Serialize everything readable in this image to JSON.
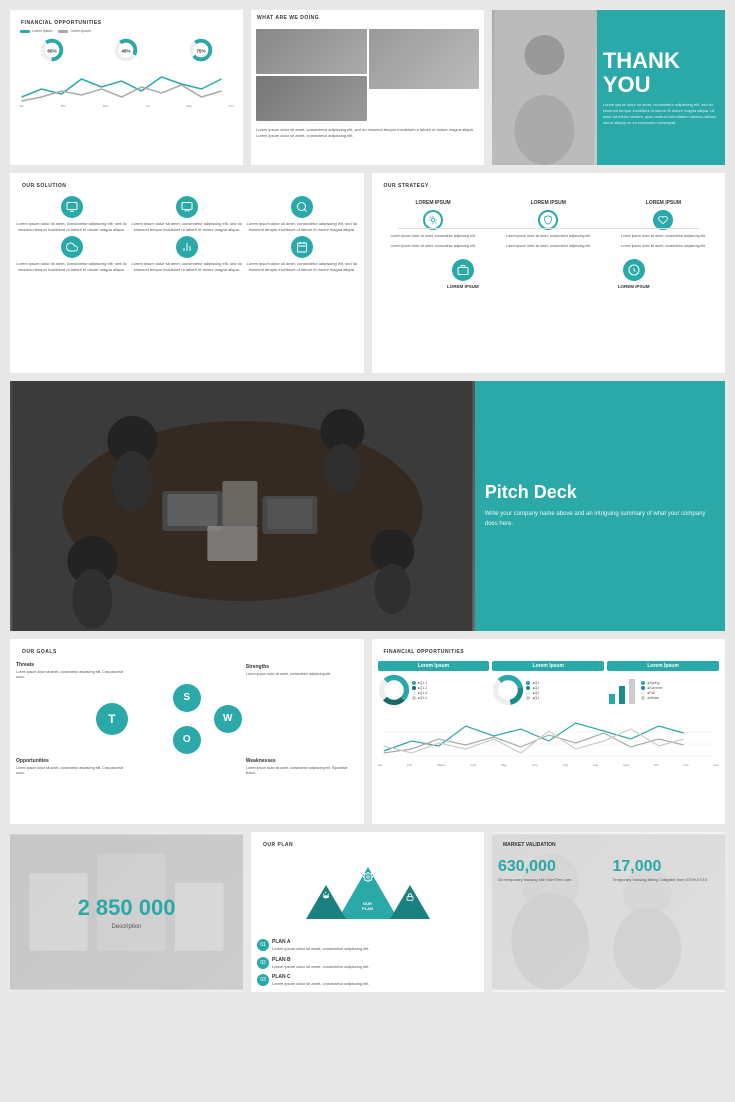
{
  "slides": {
    "row1": {
      "slide1": {
        "title": "FINANCIAL OPPORTUNITIES",
        "donut1": {
          "color": "#2ba8a8",
          "value": 65
        },
        "donut2": {
          "color": "#2ba8a8",
          "value": 45
        },
        "donut3": {
          "color": "#2ba8a8",
          "value": 75
        }
      },
      "slide2": {
        "title": "WHAT ARE WE DOING",
        "body_text": "Lorem ipsum dolor sit amet, consectetur adipiscing elit, sed do eiusmod tempor incididunt ut labore et dolore magna aliqua."
      },
      "slide3": {
        "title": "THANK YOU",
        "body_text": "Lorem ipsum dolor sit amet, consectetur adipiscing elit, sed do eiusmod tempor incididunt ut labore et dolore magna aliqua. Ut enim ad minim veniam, quis nostrud exercitation ullamco laboris nisi ut aliquip ex ea commodo consequat."
      }
    },
    "row2": {
      "slide4": {
        "title": "OUR SOLUTION",
        "items": [
          {
            "icon": "monitor",
            "text": "Lorem ipsum dolor sit amet, consectetur adipiscing elit, sed do eiusmod tempor incididunt ut labore et dolore magna aliqua."
          },
          {
            "icon": "desktop",
            "text": "Lorem ipsum dolor sit amet, consectetur adipiscing elit, sed do eiusmod tempor incididunt ut labore et dolore magna aliqua."
          },
          {
            "icon": "search",
            "text": "Lorem ipsum dolor sit amet, consectetur adipiscing elit, sed do eiusmod tempor incididunt ut labore et dolore magna aliqua."
          },
          {
            "icon": "cloud",
            "text": "Lorem ipsum dolor sit amet, consectetur adipiscing elit, sed do eiusmod tempor incididunt ut labore et dolore magna aliqua."
          },
          {
            "icon": "chart",
            "text": "Lorem ipsum dolor sit amet, consectetur adipiscing elit, sed do eiusmod tempor incididunt ut labore et dolore magna aliqua."
          },
          {
            "icon": "calendar",
            "text": "Lorem ipsum dolor sit amet, consectetur adipiscing elit, sed do eiusmod tempor incididunt ut labore et dolore magna aliqua."
          }
        ]
      },
      "slide5": {
        "title": "OUR STRATEGY",
        "top_items": [
          {
            "label": "LOREM IPSUM"
          },
          {
            "label": "LOREM IPSUM"
          },
          {
            "label": "LOREM IPSUM"
          }
        ],
        "bottom_items": [
          {
            "label": "LOREM IPSUM"
          },
          {
            "label": "LOREM IPSUM"
          }
        ],
        "text": "Lorem ipsum dolor sit amet, consectetur adipiscing elit, sed do eiusmod tempor adipiscing elit."
      }
    },
    "row3": {
      "slide6": {
        "title": "Pitch Deck",
        "subtitle": "Write your company name above and an intriguing summary of what your company does here."
      }
    },
    "row4": {
      "slide7": {
        "title": "OUR GOALS",
        "swot": {
          "S": "Strengths",
          "W": "Weaknesses",
          "O": "Opportunities",
          "T": "Threats"
        },
        "threats_text": "Lorem ipsum dolor sit amet, consectetur adipiscing elit. Cras placerat nunc.",
        "strengths_text": "Lorem ipsum dolor sit amet, consectetur adipiscing elit.",
        "opportunities_text": "Lorem ipsum dolor sit amet, consectetur adipiscing elit. Cras placerat nunc.",
        "weaknesses_text": "Lorem ipsum dolor sit amet, consectetur adipiscing elit. Etpulvinar lectus."
      },
      "slide8": {
        "title": "FINANCIAL OPPORTUNITIES",
        "col_headers": [
          "Lorem Ipsum",
          "Lorem Ipsum",
          "Lorem Ipsum"
        ],
        "legends": [
          [
            "Q1.1",
            "Q1.2",
            "Q1.3",
            "Q1.4"
          ],
          [
            "Q1",
            "Q2",
            "Q3",
            "Q4"
          ],
          [
            "Spring",
            "Summer",
            "Fall",
            "Winter"
          ]
        ],
        "x_axis": [
          "Jan",
          "Feb",
          "March",
          "April",
          "May",
          "June",
          "July",
          "Aug",
          "Sept",
          "Oct",
          "Nov",
          "Dec"
        ]
      }
    },
    "row5": {
      "slide9": {
        "number": "2 850 000",
        "description": "Description"
      },
      "slide10": {
        "title": "OUR PLAN",
        "plan_label": "OUR PLAN",
        "items": [
          {
            "num": "01",
            "label": "PLAN A",
            "text": "Lorem ipsum dolor sit amet, consectetur adipiscing elit."
          },
          {
            "num": "02",
            "label": "PLAN B",
            "text": "Lorem ipsum dolor sit amet, consectetur adipiscing elit."
          },
          {
            "num": "03",
            "label": "PLAN C",
            "text": "Lorem ipsum dolor sit amet, consectetur adipiscing elit."
          }
        ]
      },
      "slide11": {
        "title": "MARKET VALIDATION",
        "stat1_number": "630,000",
        "stat1_desc": "On temporary housing site GumTree.com",
        "stat2_number": "17,000",
        "stat2_desc": "Temporary housing listing Craigslist from 07/09-07/10"
      }
    }
  },
  "colors": {
    "teal": "#2ba8a8",
    "dark_teal": "#1a8080",
    "text_dark": "#333333",
    "text_mid": "#555555",
    "text_light": "#888888",
    "bg_light": "#f5f5f5"
  }
}
